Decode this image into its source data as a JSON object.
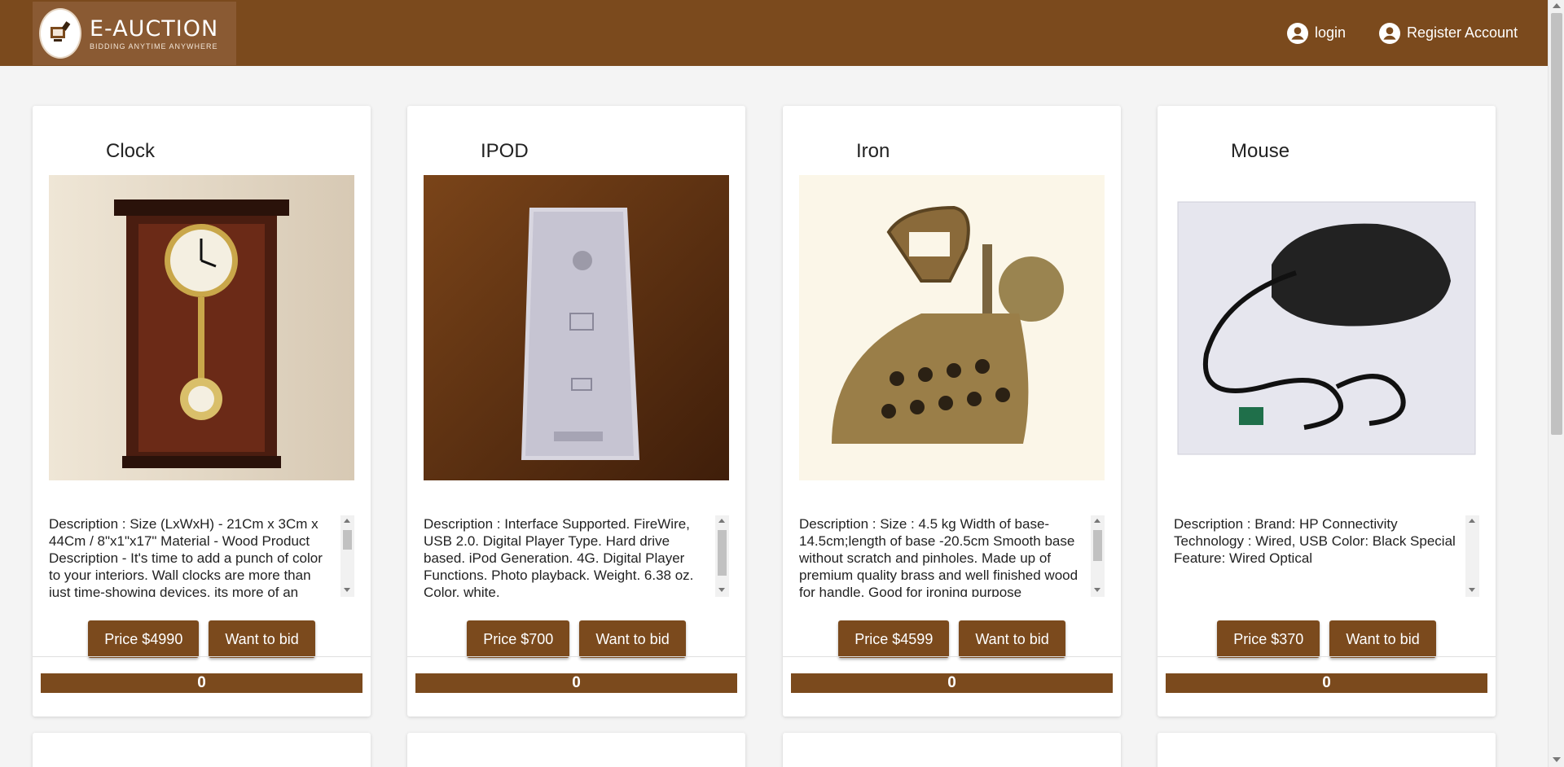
{
  "header": {
    "logo_title": "E-AUCTION",
    "logo_tagline": "BIDDING ANYTIME ANYWHERE",
    "login_label": "login",
    "register_label": "Register Account",
    "brand_color": "#7b4a1d"
  },
  "products": [
    {
      "title": "Clock",
      "description": "Description : Size (LxWxH) - 21Cm x 3Cm x 44Cm / 8\"x1\"x17\" Material - Wood Product Description - It's time to add a punch of color to your interiors. Wall clocks are more than just time-showing devices, its more of an",
      "price_label": "Price $4990",
      "bid_label": "Want to bid",
      "bid_count": "0",
      "image_icon": "wall-clock-image"
    },
    {
      "title": "IPOD",
      "description": "Description : Interface Supported. FireWire, USB 2.0. Digital Player Type. Hard drive based. iPod Generation. 4G. Digital Player Functions. Photo playback. Weight. 6.38 oz. Color. white.",
      "price_label": "Price $700",
      "bid_label": "Want to bid",
      "bid_count": "0",
      "image_icon": "ipod-image"
    },
    {
      "title": "Iron",
      "description": "Description : Size : 4.5 kg Width of base- 14.5cm;length of base -20.5cm Smooth base without scratch and pinholes. Made up of premium quality brass and well finished wood for handle. Good for ironing purpose",
      "price_label": "Price $4599",
      "bid_label": "Want to bid",
      "bid_count": "0",
      "image_icon": "antique-iron-image"
    },
    {
      "title": "Mouse",
      "description": "Description : Brand: HP Connectivity Technology : Wired, USB Color: Black Special Feature: Wired Optical",
      "price_label": "Price $370",
      "bid_label": "Want to bid",
      "bid_count": "0",
      "image_icon": "computer-mouse-image"
    }
  ]
}
